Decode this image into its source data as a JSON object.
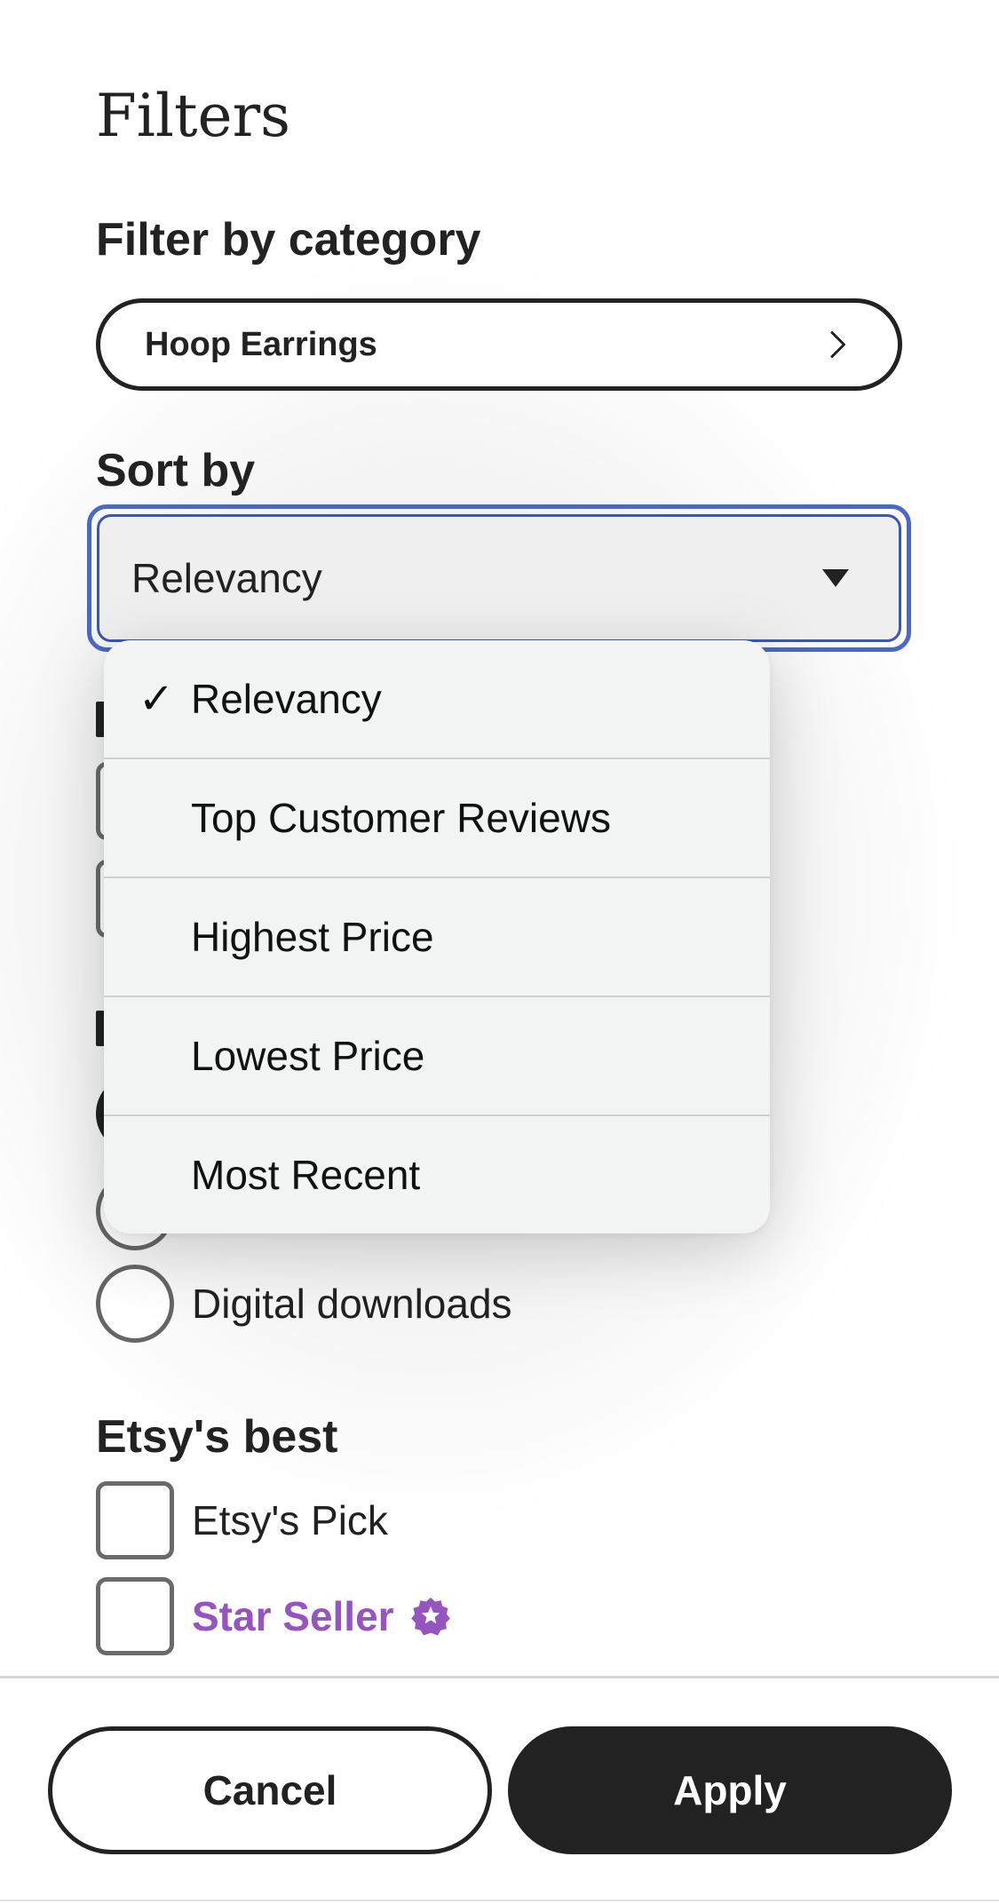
{
  "header": {
    "title": "Filters"
  },
  "category": {
    "heading": "Filter by category",
    "selected": "Hoop Earrings",
    "chevron_icon": "chevron-right-icon"
  },
  "sort": {
    "heading": "Sort by",
    "selected": "Relevancy",
    "caret_icon": "caret-down-icon",
    "focus_color": "#4a68c5",
    "options": [
      {
        "label": "Relevancy",
        "checked": true
      },
      {
        "label": "Top Customer Reviews",
        "checked": false
      },
      {
        "label": "Highest Price",
        "checked": false
      },
      {
        "label": "Lowest Price",
        "checked": false
      },
      {
        "label": "Most Recent",
        "checked": false
      }
    ],
    "check_mark": "✓"
  },
  "item_type": {
    "options": [
      {
        "label": "Digital downloads",
        "selected": false
      }
    ]
  },
  "etsys_best": {
    "heading": "Etsy's best",
    "options": [
      {
        "label": "Etsy's Pick",
        "checked": false
      },
      {
        "label": "Star Seller",
        "checked": false,
        "icon": "star-seller-badge-icon",
        "color": "#9654c0"
      }
    ]
  },
  "footer": {
    "cancel_label": "Cancel",
    "apply_label": "Apply"
  }
}
